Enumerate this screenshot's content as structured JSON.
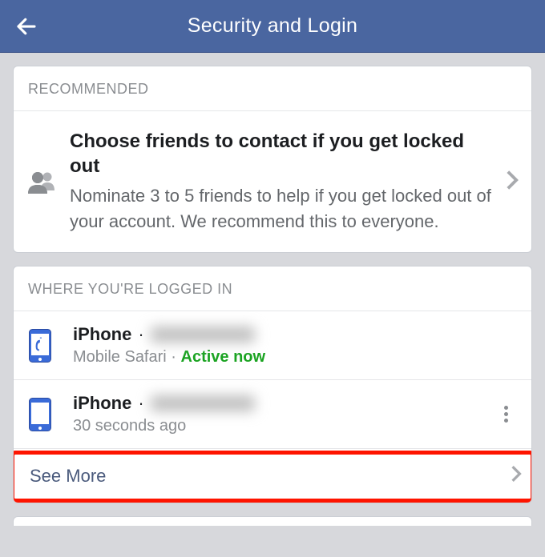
{
  "header": {
    "title": "Security and Login"
  },
  "recommended": {
    "header": "RECOMMENDED",
    "title": "Choose friends to contact if you get locked out",
    "subtitle": "Nominate 3 to 5 friends to help if you get locked out of your account. We recommend this to everyone."
  },
  "loggedIn": {
    "header": "WHERE YOU'RE LOGGED IN",
    "sessions": [
      {
        "device": "iPhone",
        "separator": " · ",
        "browser": "Mobile Safari",
        "dot": " · ",
        "status": "Active now"
      },
      {
        "device": "iPhone",
        "separator": " · ",
        "timestamp": "30 seconds ago"
      }
    ],
    "seeMore": "See More"
  }
}
